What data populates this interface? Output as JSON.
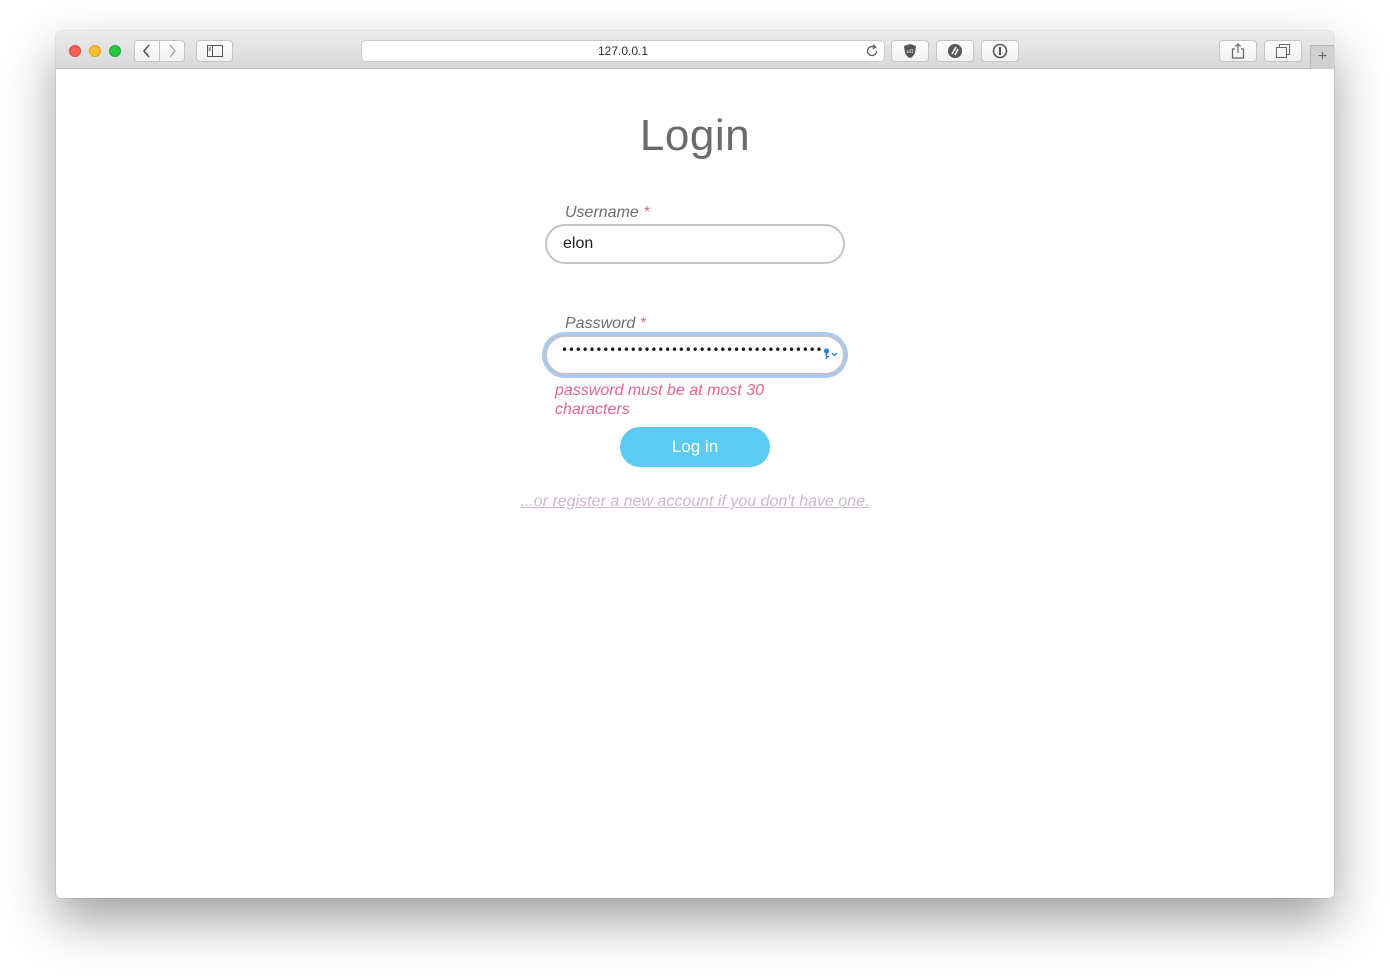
{
  "browser": {
    "url": "127.0.0.1",
    "new_tab_label": "+",
    "icons": {
      "back": "chevron-left-icon",
      "forward": "chevron-right-icon",
      "sidebar": "sidebar-icon",
      "reload": "reload-icon",
      "ext1": "ublock-icon",
      "ext2": "grammarly-icon",
      "ext3": "1password-icon",
      "share": "share-icon",
      "tabs": "tabs-overview-icon"
    }
  },
  "page": {
    "title": "Login",
    "username": {
      "label": "Username",
      "required_mark": "*",
      "value": "elon"
    },
    "password": {
      "label": "Password",
      "required_mark": "*",
      "masked_value": "••••••••••••••••••••••••••••••••••••••••••"
    },
    "error": "password must be at most 30 characters",
    "login_button": "Log in",
    "register_link": "...or register a new account if you don't have one."
  },
  "colors": {
    "accent_button": "#5bcbf3",
    "error": "#e4648d",
    "link": "#cab8cc",
    "title": "#6a6a6a"
  }
}
